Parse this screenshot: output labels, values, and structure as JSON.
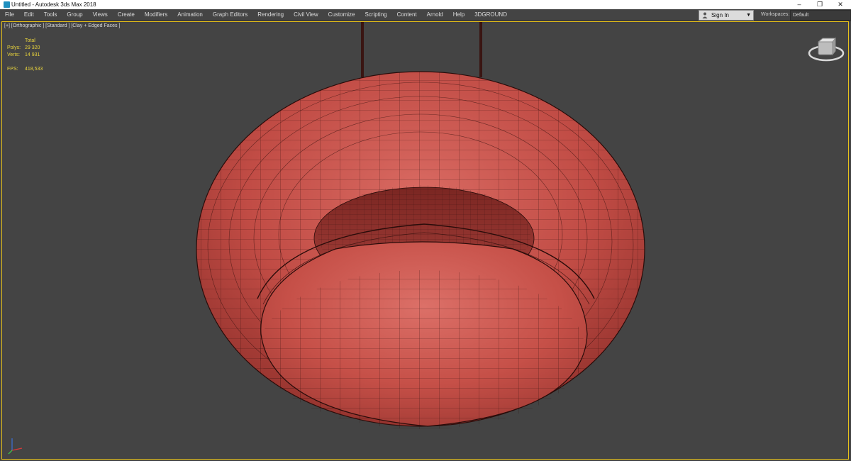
{
  "titlebar": {
    "title": "Untitled - Autodesk 3ds Max 2018",
    "minimize": "–",
    "restore": "❐",
    "close": "✕"
  },
  "menu": {
    "items": [
      "File",
      "Edit",
      "Tools",
      "Group",
      "Views",
      "Create",
      "Modifiers",
      "Animation",
      "Graph Editors",
      "Rendering",
      "Civil View",
      "Customize",
      "Scripting",
      "Content",
      "Arnold",
      "Help",
      "3DGROUND"
    ],
    "signin": "Sign In",
    "workspaces_label": "Workspaces:",
    "workspace_value": "Default"
  },
  "viewport": {
    "label": "[+] [Orthographic ] [Standard ] [Clay + Edged Faces ]",
    "stats": {
      "total": "Total",
      "polys_label": "Polys:",
      "polys": "29 320",
      "verts_label": "Verts:",
      "verts": "14 931",
      "fps_label": "FPS:",
      "fps": "418,533"
    }
  },
  "colors": {
    "accent": "#e8c21a",
    "clay": "#c3514a",
    "background": "#444444"
  }
}
